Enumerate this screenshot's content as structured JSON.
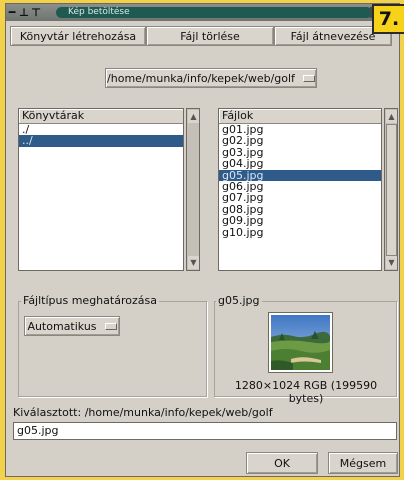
{
  "window": {
    "title": "Kép betöltése",
    "badge": "7."
  },
  "toolbar": {
    "create_dir": "Könyvtár létrehozása",
    "delete_file": "Fájl törlése",
    "rename_file": "Fájl átnevezése"
  },
  "path_dropdown": {
    "value": "/home/munka/info/kepek/web/golf"
  },
  "directories": {
    "header": "Könyvtárak",
    "items": [
      "./",
      "../"
    ],
    "selected_index": 1
  },
  "files": {
    "header": "Fájlok",
    "items": [
      "g01.jpg",
      "g02.jpg",
      "g03.jpg",
      "g04.jpg",
      "g05.jpg",
      "g06.jpg",
      "g07.jpg",
      "g08.jpg",
      "g09.jpg",
      "g10.jpg"
    ],
    "selected_index": 4
  },
  "filetype": {
    "label": "Fájltípus meghatározása",
    "value": "Automatikus"
  },
  "preview": {
    "filename": "g05.jpg",
    "info": "1280×1024 RGB (199590 bytes)"
  },
  "selection": {
    "label": "Kiválasztott: /home/munka/info/kepek/web/golf",
    "value": "g05.jpg"
  },
  "buttons": {
    "ok": "OK",
    "cancel": "Mégsem"
  },
  "colors": {
    "selection": "#2f5b8a",
    "dialog_bg": "#d4d0c8",
    "page_bg": "#f2d24a"
  }
}
